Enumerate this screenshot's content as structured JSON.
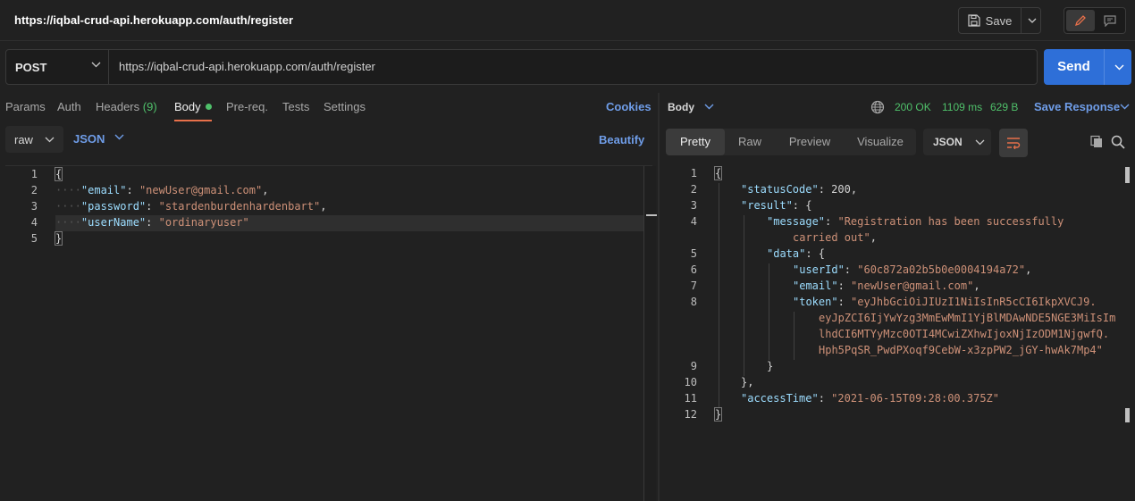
{
  "header": {
    "title": "https://iqbal-crud-api.herokuapp.com/auth/register",
    "save_label": "Save"
  },
  "request": {
    "method": "POST",
    "url": "https://iqbal-crud-api.herokuapp.com/auth/register",
    "send_label": "Send"
  },
  "request_tabs": {
    "params": "Params",
    "auth": "Auth",
    "headers": "Headers",
    "headers_count": "(9)",
    "body": "Body",
    "prereq": "Pre-req.",
    "tests": "Tests",
    "settings": "Settings",
    "cookies": "Cookies"
  },
  "body_options": {
    "type": "raw",
    "language": "JSON",
    "beautify": "Beautify"
  },
  "request_body": {
    "line_numbers": [
      "1",
      "2",
      "3",
      "4",
      "5"
    ],
    "open": "{",
    "close": "}",
    "email_key": "\"email\"",
    "email_val": "\"newUser@gmail.com\"",
    "password_key": "\"password\"",
    "password_val": "\"stardenburdenhardenbart\"",
    "username_key": "\"userName\"",
    "username_val": "\"ordinaryuser\""
  },
  "response": {
    "body_label": "Body",
    "status": "200 OK",
    "time": "1109 ms",
    "size": "629 B",
    "save_response": "Save Response",
    "view_tabs": [
      "Pretty",
      "Raw",
      "Preview",
      "Visualize"
    ],
    "format": "JSON",
    "line_numbers": [
      "1",
      "2",
      "3",
      "4",
      "",
      "5",
      "6",
      "7",
      "8",
      "",
      "",
      "",
      "9",
      "10",
      "11",
      "12"
    ],
    "statusCode_key": "\"statusCode\"",
    "statusCode_val": "200",
    "result_key": "\"result\"",
    "message_key": "\"message\"",
    "message_val_1": "\"Registration has been successfully",
    "message_val_2": "carried out\"",
    "data_key": "\"data\"",
    "userId_key": "\"userId\"",
    "userId_val": "\"60c872a02b5b0e0004194a72\"",
    "email_key": "\"email\"",
    "email_val": "\"newUser@gmail.com\"",
    "token_key": "\"token\"",
    "token_1": "\"eyJhbGciOiJIUzI1NiIsInR5cCI6IkpXVCJ9.",
    "token_2": "eyJpZCI6IjYwYzg3MmEwMmI1YjBlMDAwNDE5NGE3MiIsIm",
    "token_3": "lhdCI6MTYyMzc0OTI4MCwiZXhwIjoxNjIzODM1NjgwfQ.",
    "token_4": "Hph5PqSR_PwdPXoqf9CebW-x3zpPW2_jGY-hwAk7Mp4\"",
    "accessTime_key": "\"accessTime\"",
    "accessTime_val": "\"2021-06-15T09:28:00.375Z\""
  },
  "colors": {
    "accent": "#2e6fd8",
    "link": "#6f9de8",
    "success": "#4fc06a",
    "active_tab_underline": "#e8704a"
  }
}
